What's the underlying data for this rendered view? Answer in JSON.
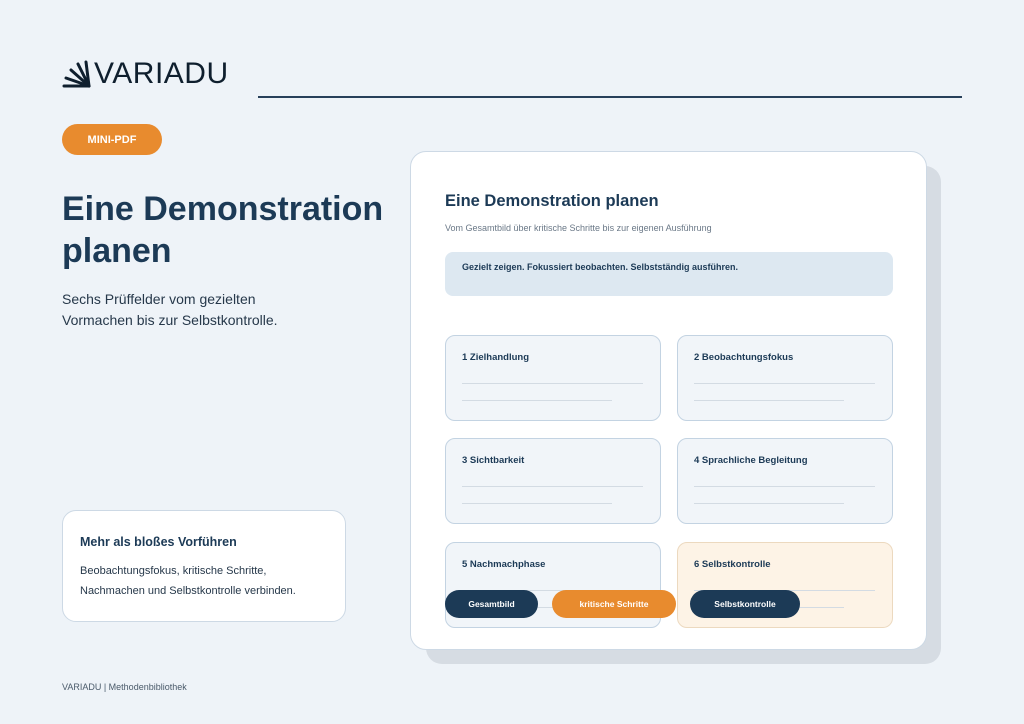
{
  "logo": {
    "text": "VARIADU",
    "icon": "sunburst-logo-icon"
  },
  "badge": "MINI-PDF",
  "hero": {
    "title": "Eine Demonstration planen",
    "subtitle": "Sechs Prüffelder vom gezielten Vormachen bis zur Selbstkontrolle."
  },
  "info_box": {
    "title": "Mehr als bloßes Vorführen",
    "text": "Beobachtungsfokus, kritische Schritte, Nachmachen und Selbstkontrolle verbinden."
  },
  "footer": "VARIADU | Methodenbibliothek",
  "card": {
    "title": "Eine Demonstration planen",
    "subtitle": "Vom Gesamtbild über kritische Schritte bis zur eigenen Ausführung",
    "highlight": "Gezielt zeigen. Fokussiert beobachten. Selbstständig ausführen.",
    "fields": [
      {
        "label": "1  Zielhandlung"
      },
      {
        "label": "2  Beobachtungsfokus"
      },
      {
        "label": "3  Sichtbarkeit"
      },
      {
        "label": "4  Sprachliche Begleitung"
      },
      {
        "label": "5  Nachmachphase"
      },
      {
        "label": "6  Selbstkontrolle"
      }
    ],
    "pills": [
      "Gesamtbild",
      "kritische Schritte",
      "Selbstkontrolle"
    ]
  },
  "colors": {
    "navy": "#1c3a56",
    "orange": "#e88b2e",
    "background": "#eef3f8",
    "highlight_fill": "#dde8f1",
    "accent_field_fill": "#fdf3e6"
  }
}
